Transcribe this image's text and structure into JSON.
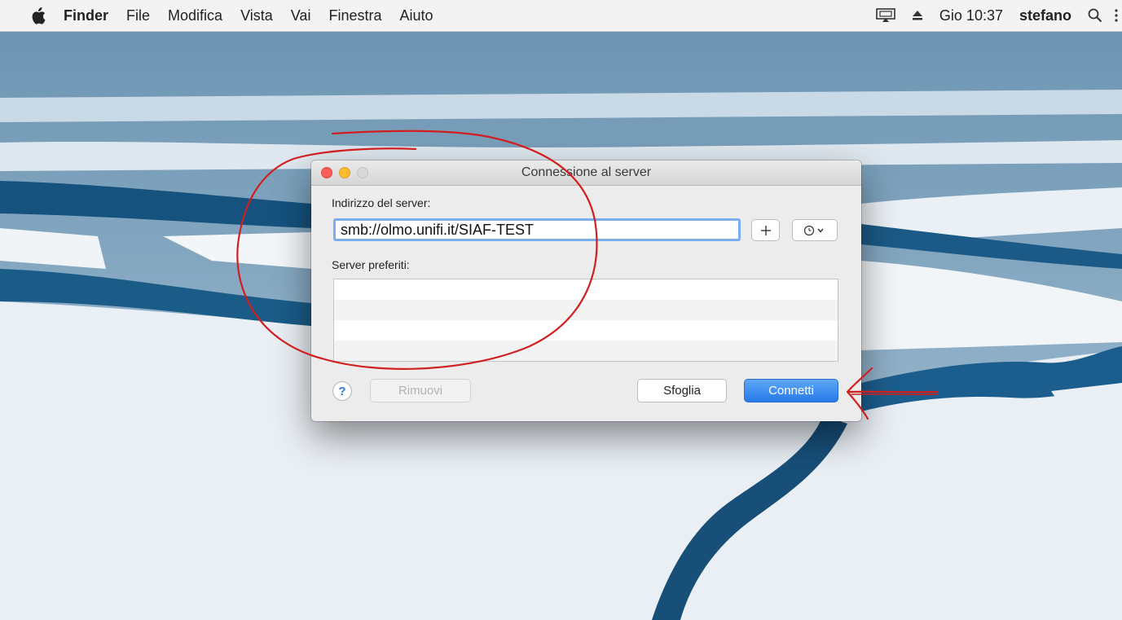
{
  "menubar": {
    "app_name": "Finder",
    "items": [
      "File",
      "Modifica",
      "Vista",
      "Vai",
      "Finestra",
      "Aiuto"
    ],
    "clock": "Gio 10:37",
    "user": "stefano",
    "icons": [
      "apple-icon",
      "airplay-icon",
      "eject-icon",
      "spotlight-search-icon"
    ]
  },
  "dialog": {
    "title": "Connessione al server",
    "address_label": "Indirizzo del server:",
    "address_value": "smb://olmo.unifi.it/SIAF-TEST",
    "add_icon": "plus-icon",
    "recent_icon": "clock-chevron-icon",
    "favorites_label": "Server preferiti:",
    "favorites": [],
    "help_label": "?",
    "remove_label": "Rimuovi",
    "browse_label": "Sfoglia",
    "connect_label": "Connetti"
  },
  "colors": {
    "accent": "#2f7ae5",
    "annotation": "#d11f1f",
    "traffic_close": "#fc5f57",
    "traffic_minimize": "#fdbc2e"
  }
}
